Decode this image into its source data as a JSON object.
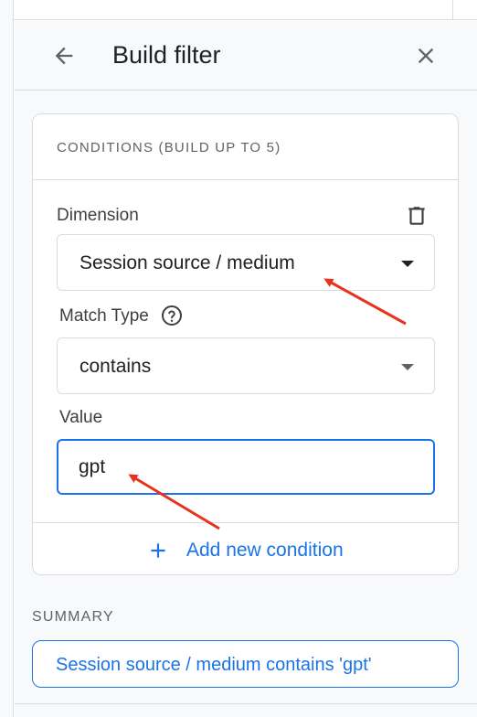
{
  "header": {
    "title": "Build filter",
    "back_icon": "arrow-left-icon",
    "close_icon": "close-icon"
  },
  "conditions": {
    "title": "CONDITIONS (BUILD UP TO 5)",
    "dimension": {
      "label": "Dimension",
      "value": "Session source / medium",
      "delete_icon": "trash-icon"
    },
    "match_type": {
      "label": "Match Type",
      "value": "contains",
      "help_icon": "help-circle-icon"
    },
    "value_field": {
      "label": "Value",
      "value": "gpt"
    },
    "add_condition": {
      "label": "Add new condition",
      "icon": "plus-icon"
    }
  },
  "summary": {
    "label": "SUMMARY",
    "text": "Session source / medium contains 'gpt'"
  },
  "colors": {
    "accent": "#1a73e8",
    "annotation_arrow": "#e8321e",
    "panel_bg": "#f8f9fa",
    "border": "#dadce0"
  }
}
